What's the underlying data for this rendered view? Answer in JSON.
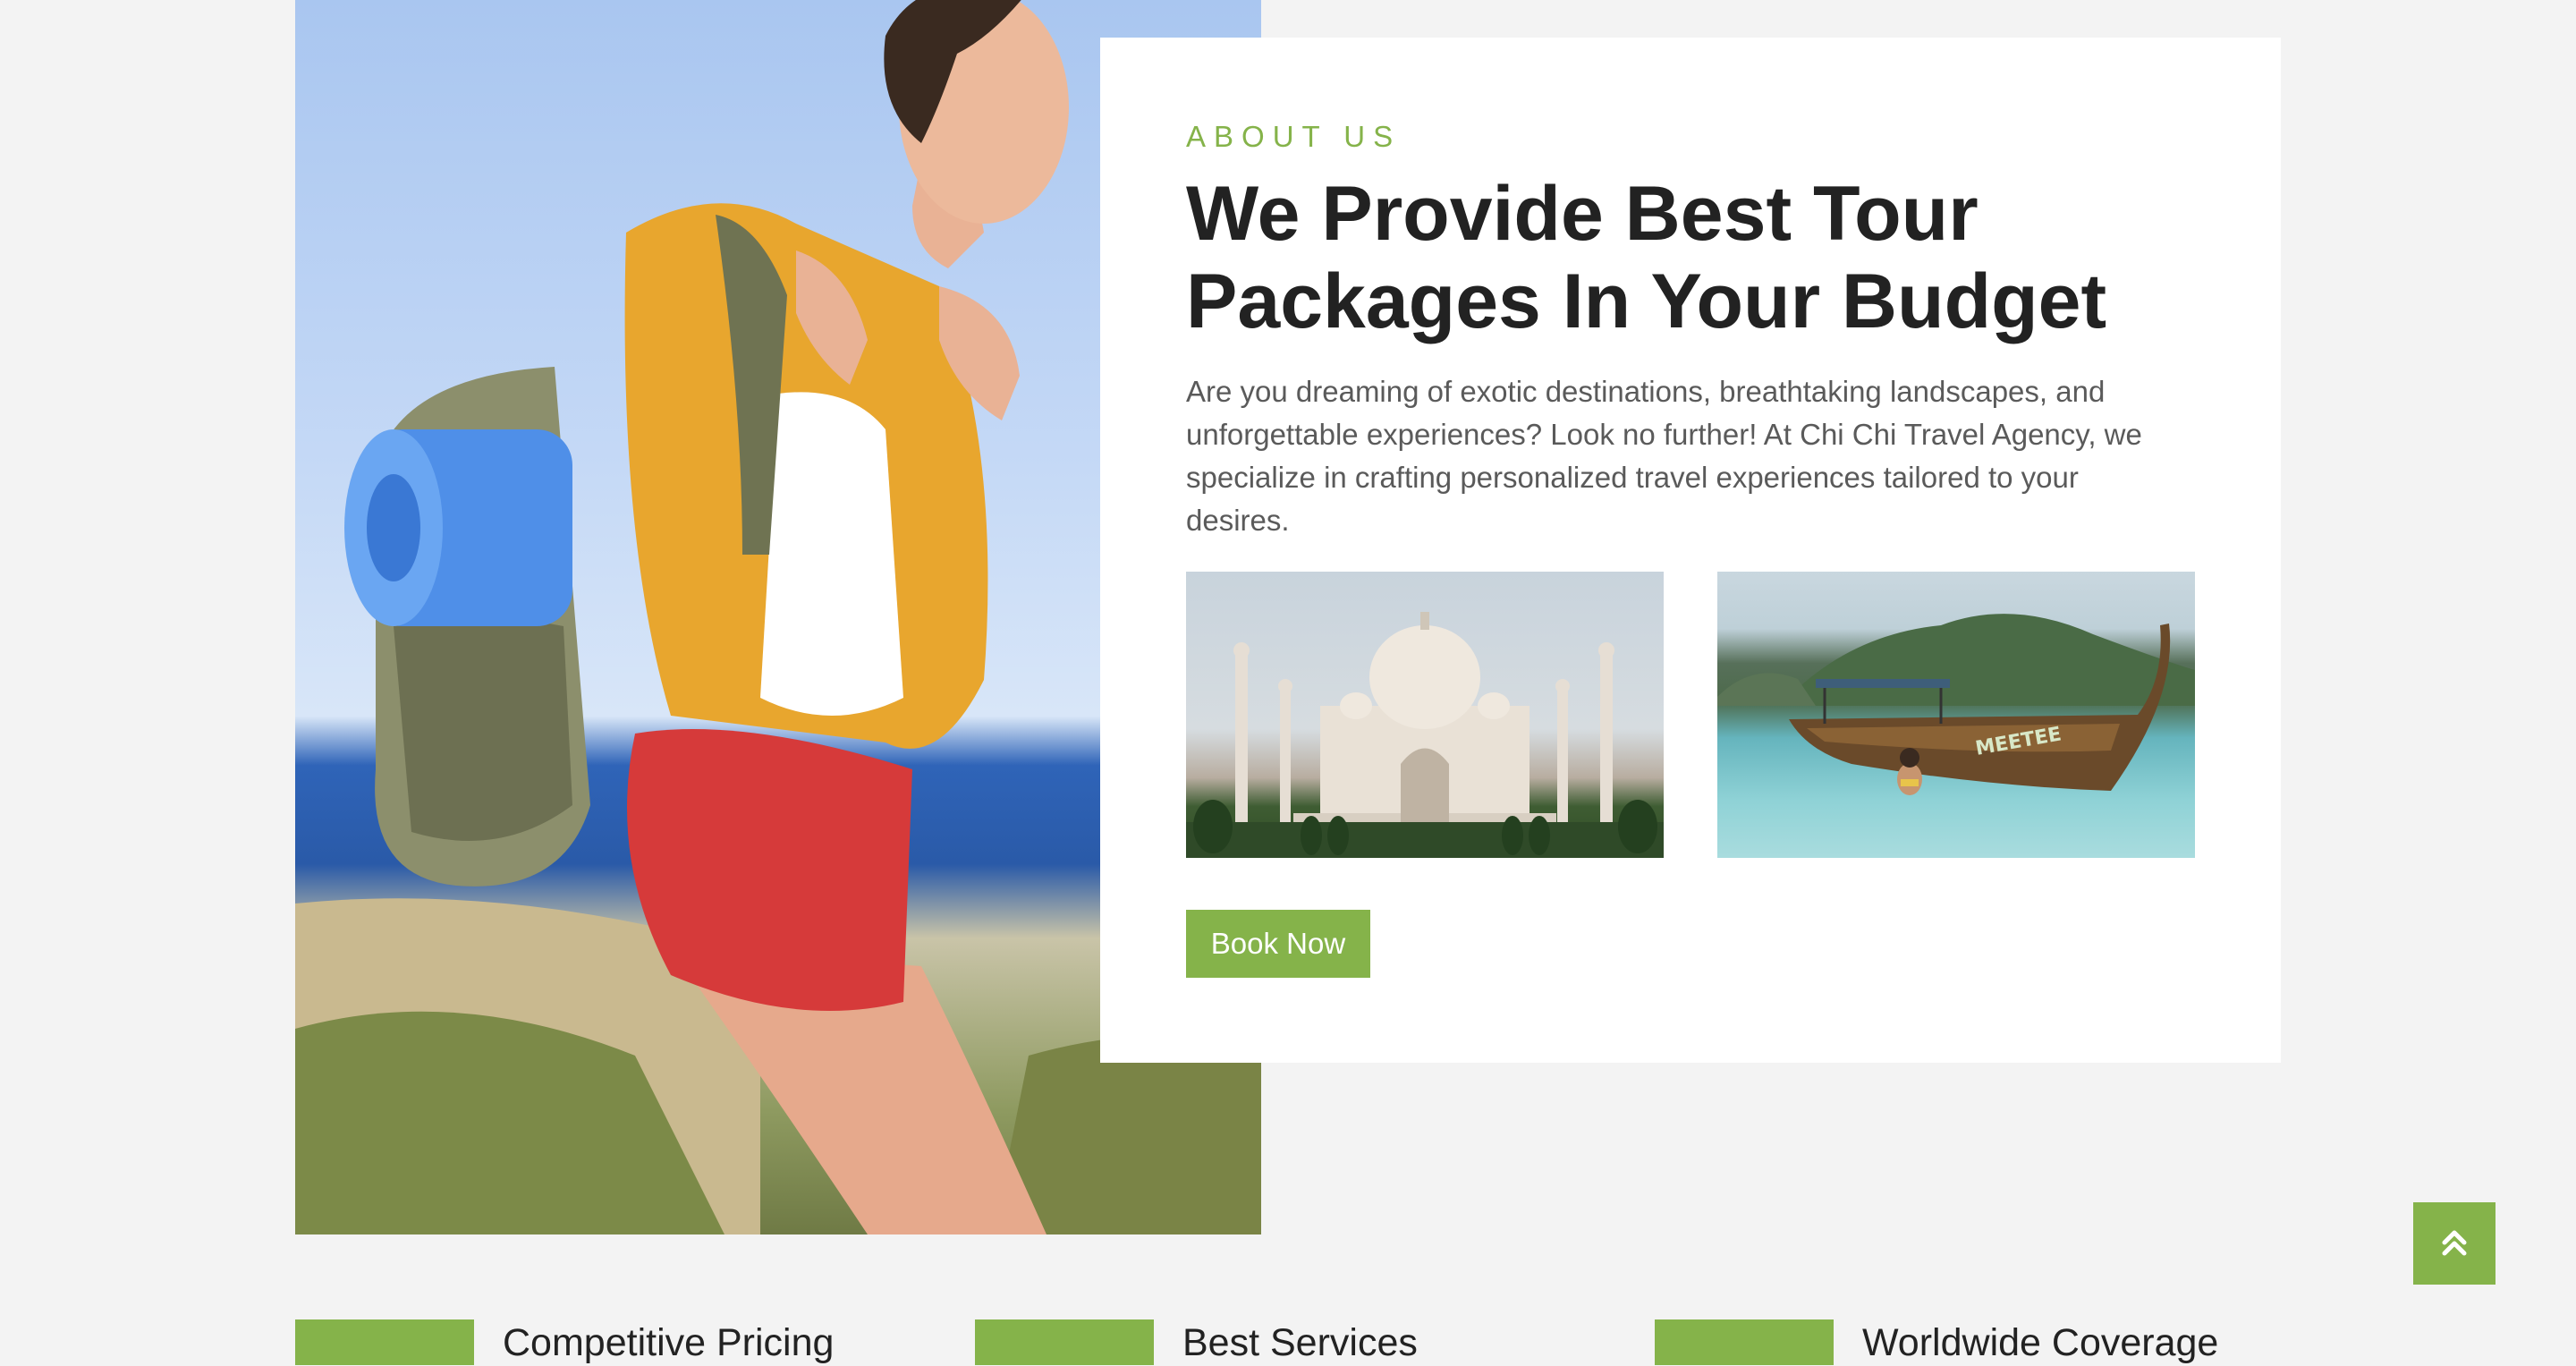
{
  "about": {
    "eyebrow": "ABOUT US",
    "heading_line1": "We Provide Best Tour",
    "heading_line2": "Packages In Your Budget",
    "description": "Are you dreaming of exotic destinations, breathtaking landscapes, and unforgettable experiences? Look no further! At Chi Chi Travel Agency, we specialize in crafting personalized travel experiences tailored to your desires.",
    "cta_label": "Book Now",
    "boat_text": "MEETEE"
  },
  "features": [
    {
      "title": "Competitive Pricing"
    },
    {
      "title": "Best Services"
    },
    {
      "title": "Worldwide Coverage"
    }
  ],
  "icons": {
    "back_to_top": "double-chevron-up-icon"
  },
  "colors": {
    "accent": "#85b34a",
    "page_bg": "#f3f3f3",
    "card_bg": "#ffffff",
    "heading": "#222222",
    "body_text": "#5a5a5a"
  }
}
